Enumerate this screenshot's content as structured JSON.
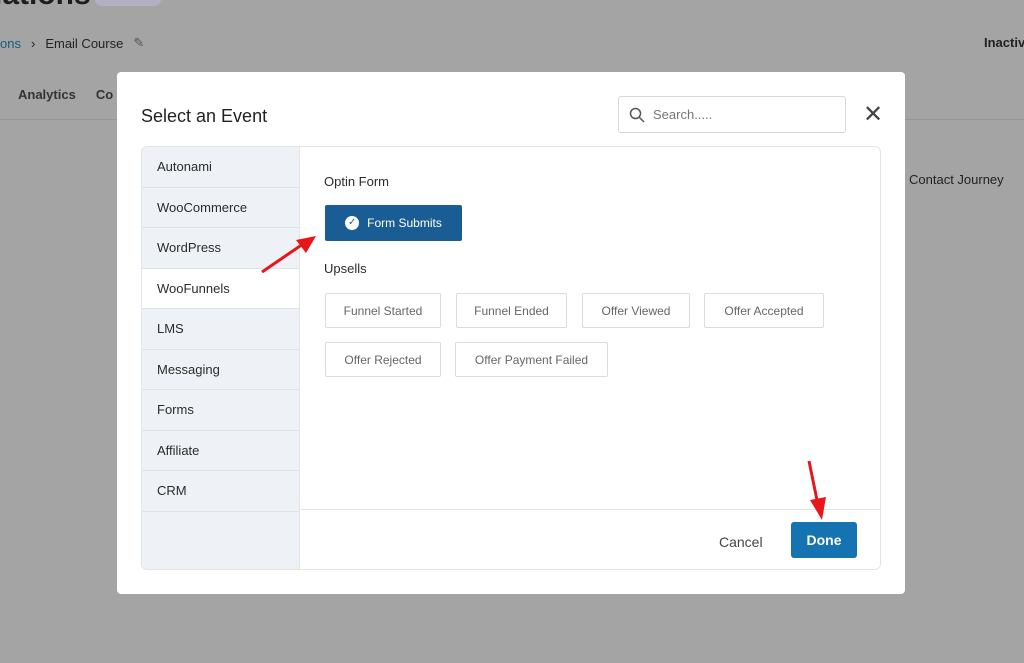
{
  "background": {
    "title": "lations",
    "breadcrumb_link": "ons",
    "breadcrumb_current": "Email Course",
    "status": "Inactiv",
    "tabs": [
      "Analytics",
      "Co"
    ],
    "contact_journey": "Contact Journey"
  },
  "modal": {
    "title": "Select an Event",
    "search_placeholder": "Search.....",
    "categories": [
      "Autonami",
      "WooCommerce",
      "WordPress",
      "WooFunnels",
      "LMS",
      "Messaging",
      "Forms",
      "Affiliate",
      "CRM"
    ],
    "active_category": "WooFunnels",
    "sections": {
      "optin": {
        "title": "Optin Form",
        "events": [
          "Form Submits"
        ],
        "selected": "Form Submits"
      },
      "upsells": {
        "title": "Upsells",
        "events": [
          "Funnel Started",
          "Funnel Ended",
          "Offer Viewed",
          "Offer Accepted",
          "Offer Rejected",
          "Offer Payment Failed"
        ]
      }
    },
    "cancel_label": "Cancel",
    "done_label": "Done"
  },
  "colors": {
    "primary": "#1a5d95",
    "done": "#1673b1",
    "annotation_arrow": "#e8161b"
  }
}
